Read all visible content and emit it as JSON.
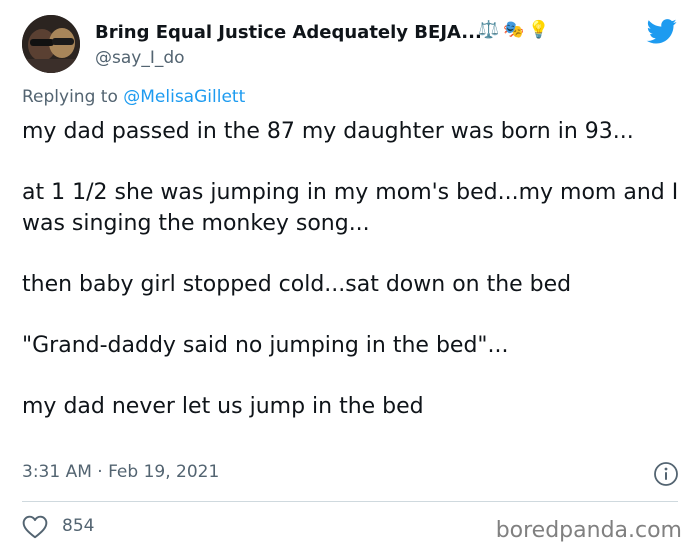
{
  "author": {
    "display_name": "Bring Equal Justice Adequately BEJA...",
    "handle": "@say_I_do",
    "badges": [
      "⚖️",
      "🎭",
      "💡"
    ]
  },
  "reply": {
    "prefix": "Replying to ",
    "mention": "@MelisaGillett"
  },
  "tweet": {
    "lines": [
      "my dad passed in the 87 my daughter was born in 93...",
      "at 1 1/2 she was jumping in my mom's bed...my mom and I was singing the monkey song...",
      "then baby girl stopped cold...sat down on the bed",
      "\"Grand-daddy said no jumping in the bed\"...",
      "my dad never let us jump in the bed"
    ],
    "timestamp": "3:31 AM · Feb 19, 2021"
  },
  "engagement": {
    "likes": "854"
  },
  "watermark": "boredpanda.com",
  "colors": {
    "twitter_blue": "#1d9bf0",
    "secondary_text": "#536471",
    "primary_text": "#0f1419"
  },
  "icons": {
    "brand": "twitter-bird-icon",
    "info": "info-icon",
    "like": "heart-icon"
  }
}
